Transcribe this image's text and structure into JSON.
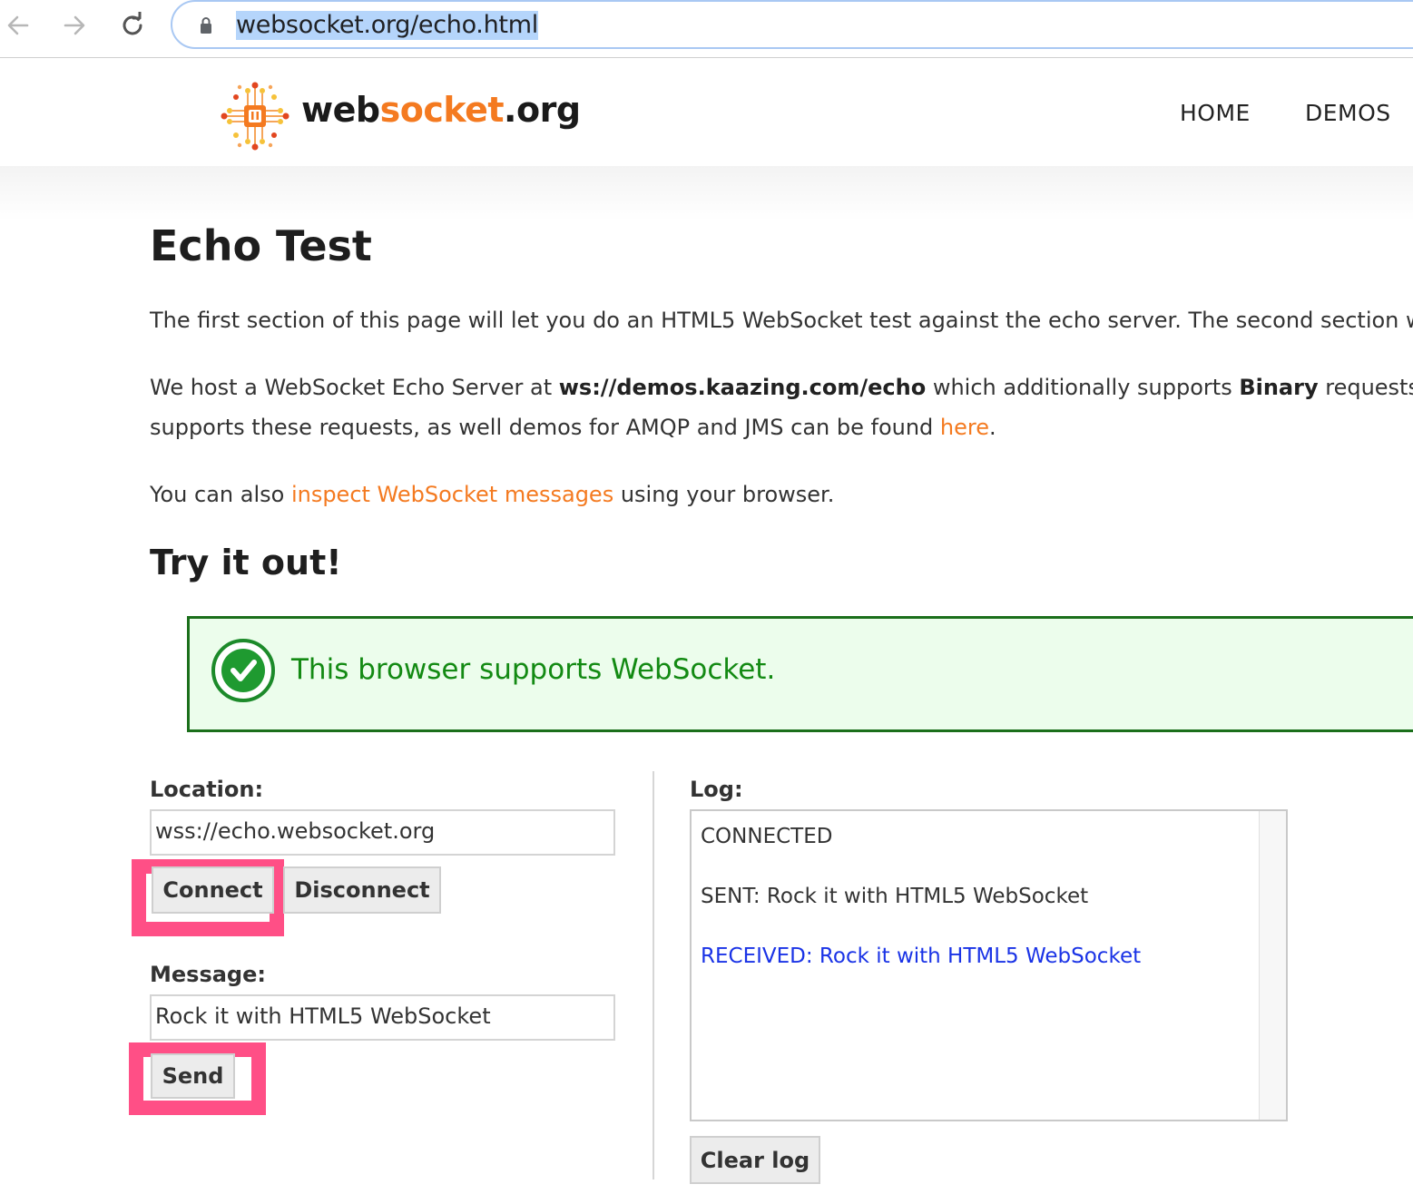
{
  "browser": {
    "url": "websocket.org/echo.html"
  },
  "site": {
    "brand": {
      "part1": "web",
      "part2": "socket",
      "part3": ".org"
    },
    "nav": [
      {
        "label": "HOME"
      },
      {
        "label": "DEMOS"
      }
    ],
    "colors": {
      "brand_orange": "#f47a20",
      "success_green": "#138a13",
      "highlight_pink": "#ff4f86",
      "received_blue": "#1a33e6"
    }
  },
  "page": {
    "title": "Echo Test",
    "intro": "The first section of this page will let you do an HTML5 WebSocket test against the echo server. The second section w",
    "host_para": {
      "prefix": "We host a WebSocket Echo Server at ",
      "server": "ws://demos.kaazing.com/echo",
      "middle": " which additionally supports ",
      "binary": "Binary",
      "suffix": " requests",
      "line2_prefix": "supports these requests, as well demos for AMQP and JMS can be found ",
      "line2_link": "here",
      "line2_suffix": "."
    },
    "inspect_para": {
      "prefix": "You can also ",
      "link": "inspect WebSocket messages",
      "suffix": " using your browser."
    },
    "try_heading": "Try it out!",
    "support_message": "This browser supports WebSocket."
  },
  "form": {
    "location_label": "Location:",
    "location_value": "wss://echo.websocket.org",
    "connect_label": "Connect",
    "disconnect_label": "Disconnect",
    "message_label": "Message:",
    "message_value": "Rock it with HTML5 WebSocket",
    "send_label": "Send"
  },
  "log": {
    "label": "Log:",
    "entries": [
      {
        "text": "CONNECTED",
        "type": "status"
      },
      {
        "text": "SENT: Rock it with HTML5 WebSocket",
        "type": "sent"
      },
      {
        "text": "RECEIVED: Rock it with HTML5 WebSocket",
        "type": "received"
      }
    ],
    "clear_label": "Clear log"
  }
}
